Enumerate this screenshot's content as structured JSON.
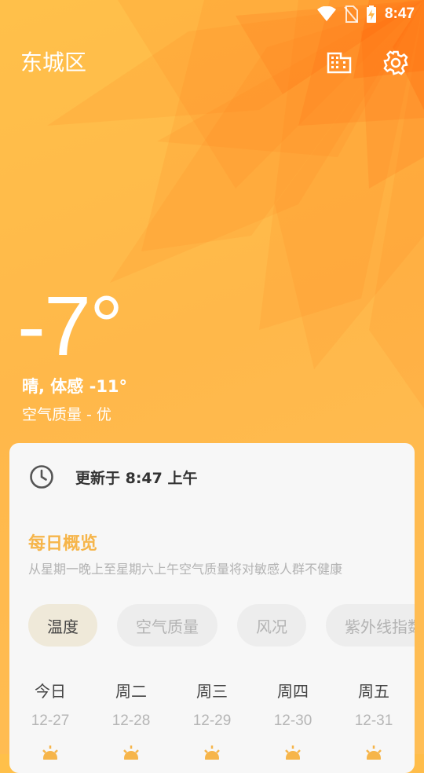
{
  "status_bar": {
    "time": "8:47",
    "icons": [
      "wifi-icon",
      "no-sim-icon",
      "battery-charging-icon"
    ]
  },
  "header": {
    "location": "东城区",
    "city_button_icon": "city-buildings-icon",
    "settings_icon": "gear-icon"
  },
  "current": {
    "temperature": "-7°",
    "description": "晴, 体感 -11°",
    "air_quality": "空气质量 - 优"
  },
  "card": {
    "update_icon": "clock-icon",
    "update_text": "更新于 8:47 上午",
    "overview_title": "每日概览",
    "overview_desc": "从星期一晚上至星期六上午空气质量将对敏感人群不健康",
    "tabs": [
      {
        "label": "温度",
        "active": true
      },
      {
        "label": "空气质量",
        "active": false
      },
      {
        "label": "风况",
        "active": false
      },
      {
        "label": "紫外线指数",
        "active": false
      }
    ],
    "days": [
      {
        "name": "今日",
        "date": "12-27",
        "icon": "sun-icon"
      },
      {
        "name": "周二",
        "date": "12-28",
        "icon": "sun-icon"
      },
      {
        "name": "周三",
        "date": "12-29",
        "icon": "sun-icon"
      },
      {
        "name": "周四",
        "date": "12-30",
        "icon": "sun-icon"
      },
      {
        "name": "周五",
        "date": "12-31",
        "icon": "sun-icon"
      }
    ]
  },
  "colors": {
    "accent": "#f6b54a",
    "background": "#ffb84a",
    "card": "#f7f7f7"
  }
}
